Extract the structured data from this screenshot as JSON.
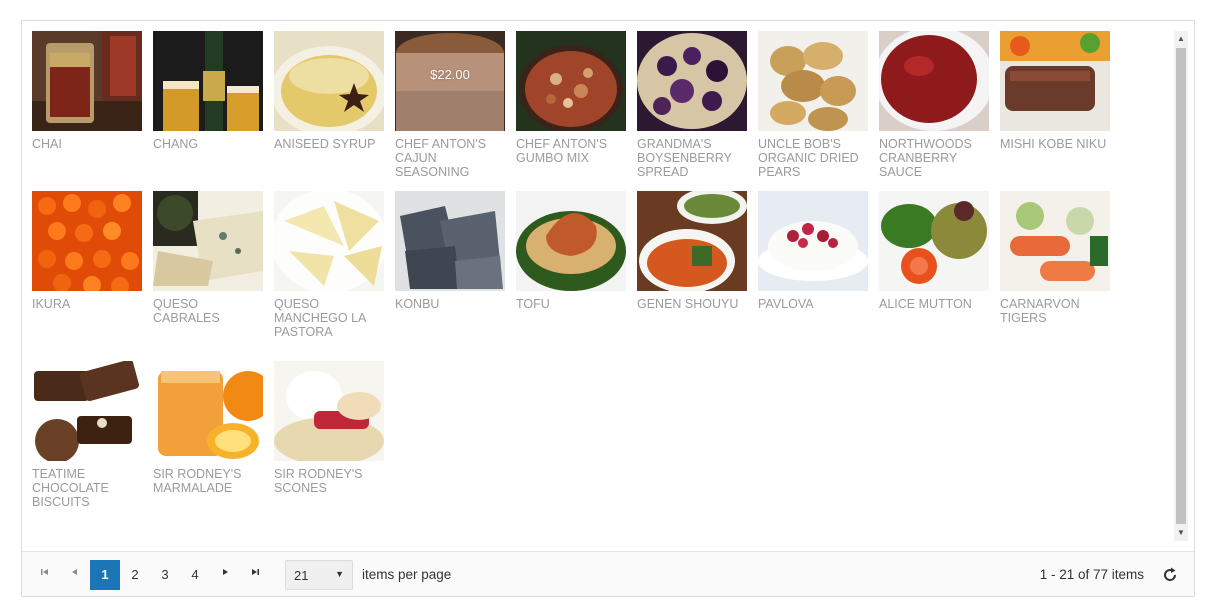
{
  "products": [
    {
      "name": "CHAI",
      "price": "",
      "image": "chai-tea-glasses"
    },
    {
      "name": "CHANG",
      "price": "",
      "image": "chang-beer-bottle"
    },
    {
      "name": "ANISEED SYRUP",
      "price": "",
      "image": "aniseed-syrup-bowl"
    },
    {
      "name": "CHEF ANTON'S CAJUN SEASONING",
      "price": "$22.00",
      "image": "cajun-seasoning-cake"
    },
    {
      "name": "CHEF ANTON'S GUMBO MIX",
      "price": "",
      "image": "gumbo-mix-pan"
    },
    {
      "name": "GRANDMA'S BOYSENBERRY SPREAD",
      "price": "",
      "image": "boysenberry-cobbler"
    },
    {
      "name": "UNCLE BOB'S ORGANIC DRIED PEARS",
      "price": "",
      "image": "dried-pears"
    },
    {
      "name": "NORTHWOODS CRANBERRY SAUCE",
      "price": "",
      "image": "cranberry-sauce-bowl"
    },
    {
      "name": "MISHI KOBE NIKU",
      "price": "",
      "image": "kobe-beef-steak"
    },
    {
      "name": "IKURA",
      "price": "",
      "image": "salmon-roe"
    },
    {
      "name": "QUESO CABRALES",
      "price": "",
      "image": "cabrales-cheese"
    },
    {
      "name": "QUESO MANCHEGO LA PASTORA",
      "price": "",
      "image": "manchego-cheese-wedges"
    },
    {
      "name": "KONBU",
      "price": "",
      "image": "konbu-seaweed"
    },
    {
      "name": "TOFU",
      "price": "",
      "image": "tofu-dish"
    },
    {
      "name": "GENEN SHOUYU",
      "price": "",
      "image": "shouyu-bowls"
    },
    {
      "name": "PAVLOVA",
      "price": "",
      "image": "pavlova-dessert"
    },
    {
      "name": "ALICE MUTTON",
      "price": "",
      "image": "alice-mutton-plate"
    },
    {
      "name": "CARNARVON TIGERS",
      "price": "",
      "image": "carnarvon-tigers-salmon"
    },
    {
      "name": "TEATIME CHOCOLATE BISCUITS",
      "price": "",
      "image": "chocolate-biscuits"
    },
    {
      "name": "SIR RODNEY'S MARMALADE",
      "price": "",
      "image": "marmalade-jar"
    },
    {
      "name": "SIR RODNEY'S SCONES",
      "price": "",
      "image": "scones-cream"
    }
  ],
  "pager": {
    "first_icon": "first-page-icon",
    "prev_icon": "previous-page-icon",
    "pages": [
      "1",
      "2",
      "3",
      "4"
    ],
    "current_page": "1",
    "next_icon": "next-page-icon",
    "last_icon": "last-page-icon",
    "page_size": "21",
    "page_size_label": "items per page",
    "info": "1 - 21 of 77 items",
    "refresh_icon": "refresh-icon"
  },
  "colors": {
    "accent": "#1a76b5",
    "product_text": "#9b9b9b",
    "border": "#dcdcdc"
  }
}
